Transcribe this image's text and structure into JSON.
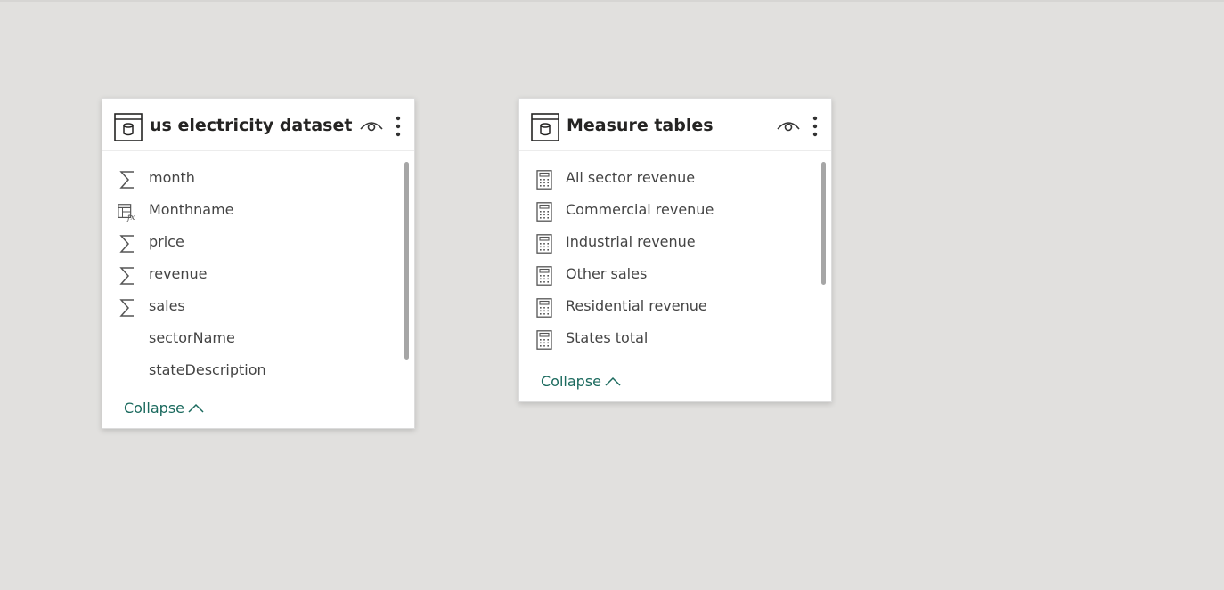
{
  "tables": [
    {
      "title": "us electricity dataset",
      "fields": [
        {
          "name": "month",
          "icon": "sigma-icon"
        },
        {
          "name": "Monthname",
          "icon": "calculated-column-icon"
        },
        {
          "name": "price",
          "icon": "sigma-icon"
        },
        {
          "name": "revenue",
          "icon": "sigma-icon"
        },
        {
          "name": "sales",
          "icon": "sigma-icon"
        },
        {
          "name": "sectorName",
          "icon": "none"
        },
        {
          "name": "stateDescription",
          "icon": "none"
        }
      ],
      "collapse_label": "Collapse"
    },
    {
      "title": "Measure tables",
      "fields": [
        {
          "name": "All sector revenue",
          "icon": "measure-calculator-icon"
        },
        {
          "name": "Commercial revenue",
          "icon": "measure-calculator-icon"
        },
        {
          "name": "Industrial revenue",
          "icon": "measure-calculator-icon"
        },
        {
          "name": "Other sales",
          "icon": "measure-calculator-icon"
        },
        {
          "name": "Residential revenue",
          "icon": "measure-calculator-icon"
        },
        {
          "name": "States total",
          "icon": "measure-calculator-icon"
        }
      ],
      "collapse_label": "Collapse"
    }
  ],
  "colors": {
    "canvas": "#e1e0de",
    "card": "#ffffff",
    "title": "#252423",
    "field_text": "#444444",
    "collapse_link": "#1b6a5e"
  }
}
